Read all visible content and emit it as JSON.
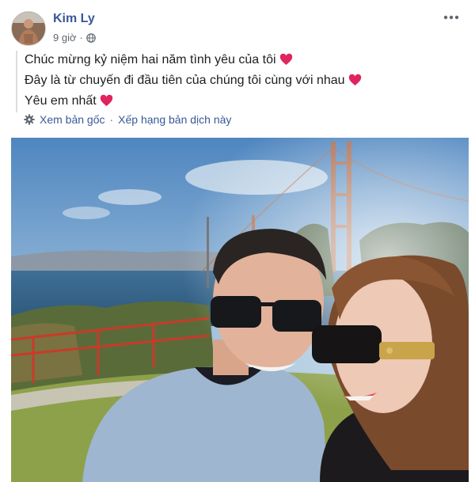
{
  "post": {
    "author": "Kim Ly",
    "time": "9 giờ",
    "privacy_icon": "globe-icon",
    "more_icon": "more-options-icon"
  },
  "translation": {
    "lines": [
      "Chúc mừng kỷ niệm hai năm tình yêu của tôi",
      "Đây là từ chuyến đi đầu tiên của chúng tôi cùng với nhau",
      "Yêu em nhất"
    ],
    "see_original": "Xem bản gốc",
    "separator": "·",
    "rate_translation": "Xếp hạng bản dịch này"
  },
  "colors": {
    "link": "#385898",
    "heart": "#e0245e",
    "meta": "#606770"
  }
}
